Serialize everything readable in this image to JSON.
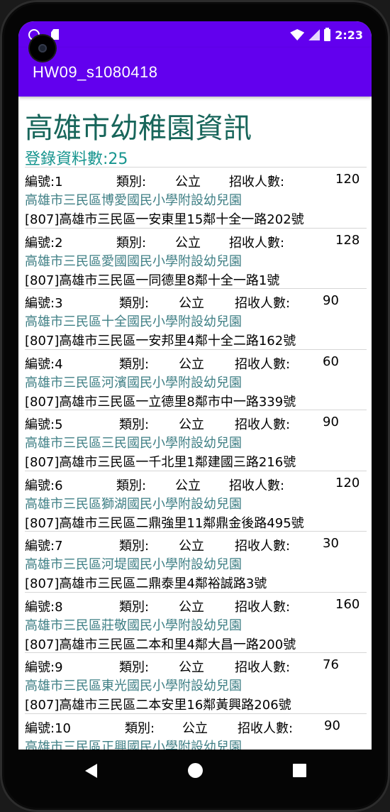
{
  "status_bar": {
    "time": "2:23",
    "icons": [
      "notification-dot-icon",
      "sim-card-icon",
      "wifi-icon",
      "signal-icon",
      "battery-icon"
    ]
  },
  "app_bar": {
    "title": "HW09_s1080418",
    "color": "#6200ee"
  },
  "main": {
    "title": "高雄市幼稚園資訊",
    "record_count": "登錄資料數:25",
    "items": [
      {
        "id": "編號:1",
        "type_label": "類別:",
        "type": "公立",
        "capacity_label": "招收人數:",
        "capacity": "120",
        "name": "高雄市三民區博愛國民小學附設幼兒園",
        "address": "[807]高雄市三民區一安東里15鄰十全一路202號"
      },
      {
        "id": "編號:2",
        "type_label": "類別:",
        "type": "公立",
        "capacity_label": "招收人數:",
        "capacity": "128",
        "name": "高雄市三民區愛國國民小學附設幼兒園",
        "address": "[807]高雄市三民區一同德里8鄰十全一路1號"
      },
      {
        "id": "編號:3",
        "type_label": "類別:",
        "type": "公立",
        "capacity_label": "招收人數:",
        "capacity": "90",
        "name": "高雄市三民區十全國民小學附設幼兒園",
        "address": "[807]高雄市三民區一安邦里4鄰十全二路162號"
      },
      {
        "id": "編號:4",
        "type_label": "類別:",
        "type": "公立",
        "capacity_label": "招收人數:",
        "capacity": "60",
        "name": "高雄市三民區河濱國民小學附設幼兒園",
        "address": "[807]高雄市三民區一立德里8鄰市中一路339號"
      },
      {
        "id": "編號:5",
        "type_label": "類別:",
        "type": "公立",
        "capacity_label": "招收人數:",
        "capacity": "90",
        "name": "高雄市三民區三民國民小學附設幼兒園",
        "address": "[807]高雄市三民區一千北里1鄰建國三路216號"
      },
      {
        "id": "編號:6",
        "type_label": "類別:",
        "type": "公立",
        "capacity_label": "招收人數:",
        "capacity": "120",
        "name": "高雄市三民區獅湖國民小學附設幼兒園",
        "address": "[807]高雄市三民區二鼎強里11鄰鼎金後路495號"
      },
      {
        "id": "編號:7",
        "type_label": "類別:",
        "type": "公立",
        "capacity_label": "招收人數:",
        "capacity": "30",
        "name": "高雄市三民區河堤國民小學附設幼兒園",
        "address": "[807]高雄市三民區二鼎泰里4鄰裕誠路3號"
      },
      {
        "id": "編號:8",
        "type_label": "類別:",
        "type": "公立",
        "capacity_label": "招收人數:",
        "capacity": "160",
        "name": "高雄市三民區莊敬國民小學附設幼兒園",
        "address": "[807]高雄市三民區二本和里4鄰大昌一路200號"
      },
      {
        "id": "編號:9",
        "type_label": "類別:",
        "type": "公立",
        "capacity_label": "招收人數:",
        "capacity": "76",
        "name": "高雄市三民區東光國民小學附設幼兒園",
        "address": "[807]高雄市三民區二本安里16鄰黃興路206號"
      },
      {
        "id": "編號:10",
        "type_label": "類別:",
        "type": "公立",
        "capacity_label": "招收人數:",
        "capacity": "90",
        "name": "高雄市三民區正興國民小學附設幼兒園",
        "address": ""
      }
    ]
  },
  "nav_bar": {
    "icons": [
      "back-icon",
      "home-icon",
      "recents-icon"
    ]
  },
  "colors": {
    "accent": "#6200ee",
    "title": "#17655a",
    "count": "#17958f",
    "name": "#3f7f85"
  }
}
